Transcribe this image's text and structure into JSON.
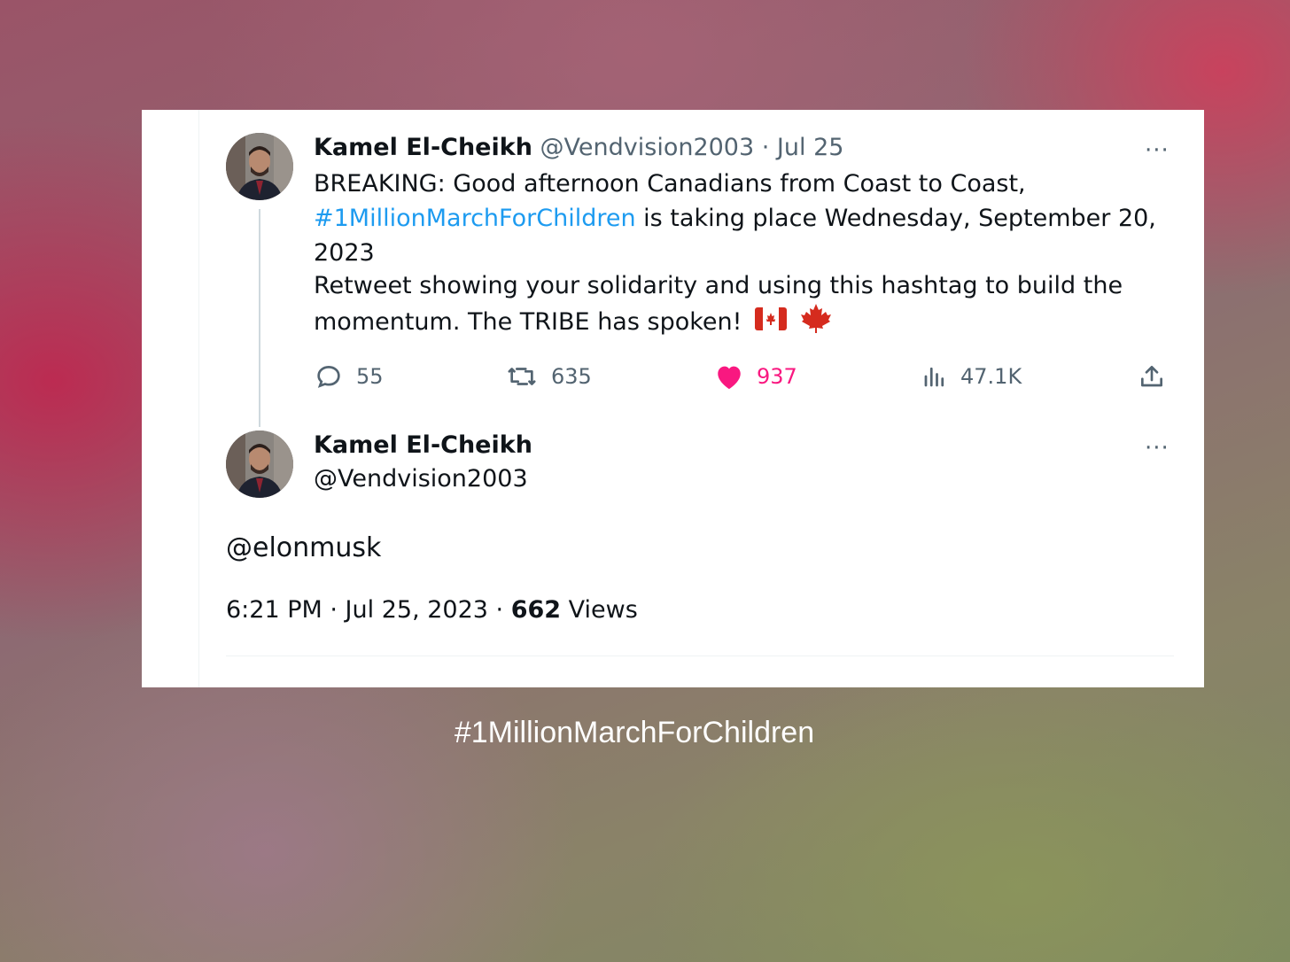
{
  "tweet1": {
    "name": "Kamel El-Cheikh",
    "handle": "@Vendvision2003",
    "sep": " · ",
    "date": "Jul 25",
    "line1": "BREAKING:  Good afternoon Canadians from Coast to Coast,",
    "hashtag": "#1MillionMarchForChildren",
    "line2_rest": " is taking place Wednesday, September 20,",
    "line3": "2023",
    "line4": "Retweet showing your solidarity and using this hashtag to build the",
    "line5": "momentum.  The TRIBE has spoken!",
    "more": "···",
    "actions": {
      "replies": "55",
      "retweets": "635",
      "likes": "937",
      "views": "47.1K"
    },
    "colors": {
      "like": "#f91880",
      "link": "#1d9bf0",
      "muted": "#536471"
    }
  },
  "tweet2": {
    "name": "Kamel El-Cheikh",
    "handle": "@Vendvision2003",
    "more": "···",
    "mention": "@elonmusk",
    "time": "6:21 PM",
    "sep1": " · ",
    "date": "Jul 25, 2023",
    "sep2": " · ",
    "views_count": "662",
    "views_label": " Views"
  },
  "caption": "#1MillionMarchForChildren"
}
